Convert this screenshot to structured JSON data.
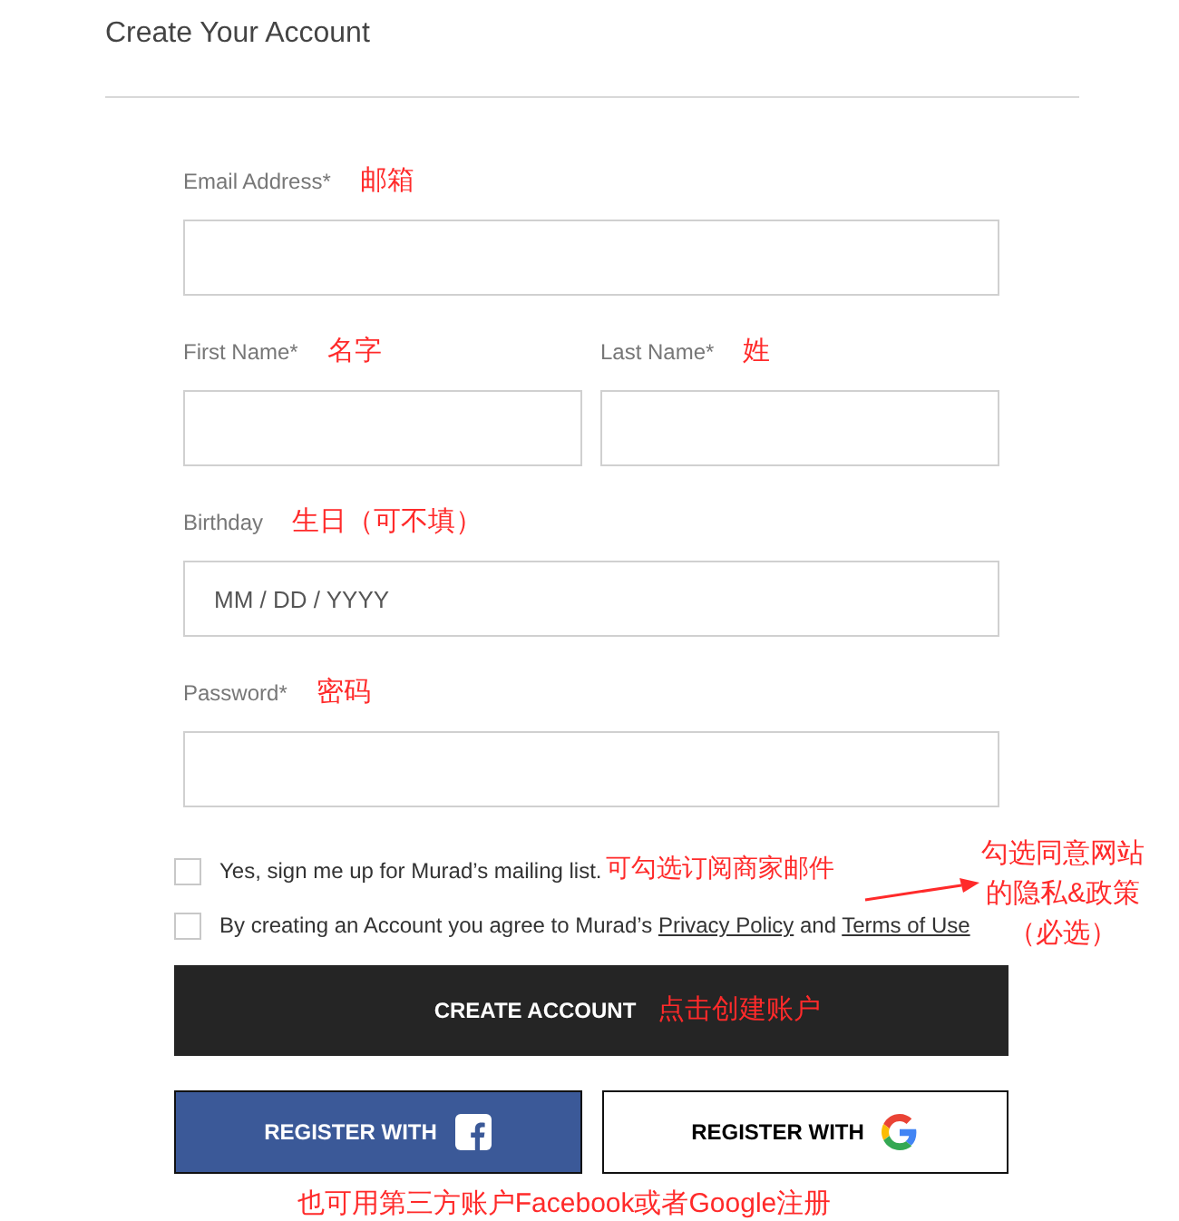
{
  "title": "Create Your Account",
  "field_rows": [
    [
      {
        "label": "Email Address*",
        "note": "邮箱"
      }
    ],
    [
      {
        "label": "First Name*",
        "note": "名字"
      },
      {
        "label": "Last Name*",
        "note": "姓"
      }
    ],
    [
      {
        "label": "Birthday",
        "note": "生日（可不填）",
        "placeholder": "MM / DD / YYYY"
      }
    ],
    [
      {
        "label": "Password*",
        "note": "密码"
      }
    ]
  ],
  "mailing": {
    "text": "Yes, sign me up for Murad’s mailing list.",
    "checked": false,
    "note": "可勾选订阅商家邮件"
  },
  "agree": {
    "prefix": "By creating an Account you agree to Murad’s",
    "link_1": "Privacy Policy",
    "middle": "and",
    "link_2": "Terms of Use",
    "checked": false,
    "note": [
      "勾选同意网站",
      "的隐私&政策",
      "（必选）"
    ]
  },
  "create": {
    "label": "CREATE ACCOUNT",
    "note": "点击创建账户"
  },
  "social": [
    {
      "kind": "facebook",
      "label": "REGISTER WITH"
    },
    {
      "kind": "google",
      "label": "REGISTER WITH"
    }
  ],
  "social_note": "也可用第三方账户Facebook或者Google注册"
}
